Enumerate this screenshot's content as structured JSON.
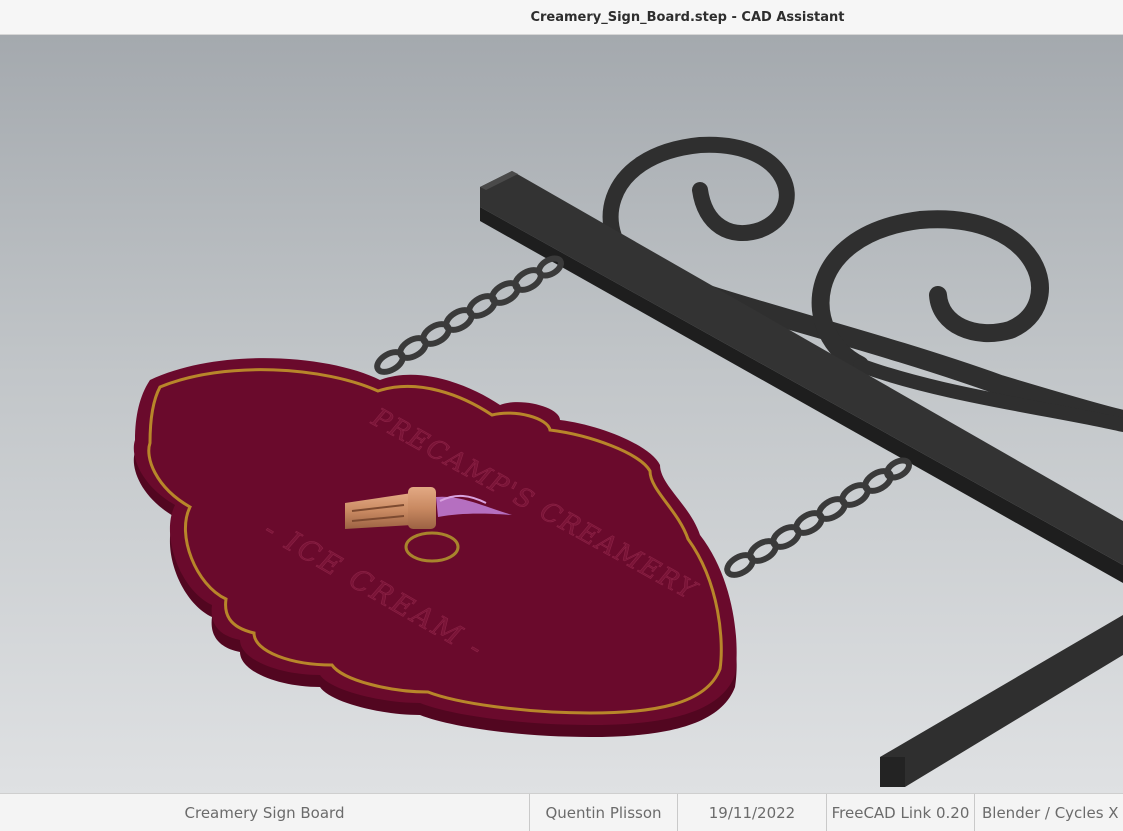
{
  "window": {
    "title": "Creamery_Sign_Board.step - CAD Assistant"
  },
  "viewport": {
    "model_name": "Creamery Sign Board",
    "sign_text_top": "PRECAMP'S CREAMERY",
    "sign_text_bottom": "- ICE CREAM -",
    "colors": {
      "background_top": "#a4a9ae",
      "background_bottom": "#dfe1e3",
      "sign_board": "#6a0a2c",
      "sign_edge": "#520620",
      "sign_trim": "#b8862a",
      "iron": "#2e2e2e",
      "cone": "#c98a62"
    }
  },
  "statusbar": {
    "fields": [
      "Creamery Sign Board",
      "Quentin Plisson",
      "19/11/2022",
      "FreeCAD Link 0.20",
      "Blender / Cycles X"
    ]
  }
}
